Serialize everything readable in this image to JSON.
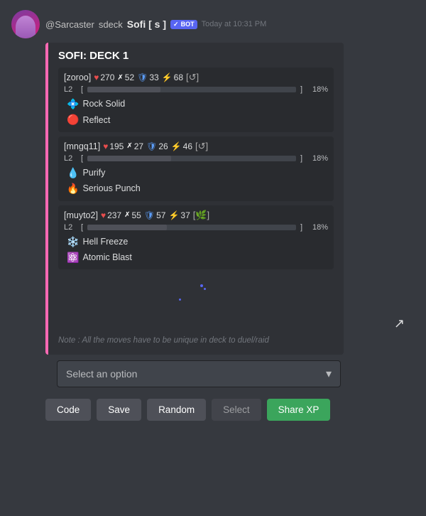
{
  "chat": {
    "user": {
      "username": "@Sarcaster",
      "sdeck": "sdeck"
    },
    "bot": {
      "name": "Sofi [ s ]",
      "badge": "BOT",
      "timestamp": "Today at 10:31 PM"
    },
    "embed": {
      "title": "SOFI: DECK 1",
      "cards": [
        {
          "player": "[zoroo]",
          "heart": 270,
          "cross": 52,
          "shield": 33,
          "bolt": 68,
          "icon": "↺",
          "level": "L2",
          "progress": 35,
          "progress_pct": "18%",
          "moves": [
            {
              "icon": "💠",
              "name": "Rock Solid"
            },
            {
              "icon": "🔴",
              "name": "Reflect"
            }
          ]
        },
        {
          "player": "[mngq11]",
          "heart": 195,
          "cross": 27,
          "shield": 26,
          "bolt": 46,
          "icon": "↺",
          "level": "L2",
          "progress": 40,
          "progress_pct": "18%",
          "moves": [
            {
              "icon": "💧",
              "name": "Purify"
            },
            {
              "icon": "🔥",
              "name": "Serious Punch"
            }
          ]
        },
        {
          "player": "[muyto2]",
          "heart": 237,
          "cross": 55,
          "shield": 57,
          "bolt": 37,
          "icon": "🌿",
          "level": "L2",
          "progress": 38,
          "progress_pct": "18%",
          "moves": [
            {
              "icon": "❄️",
              "name": "Hell Freeze"
            },
            {
              "icon": "⚛️",
              "name": "Atomic Blast"
            }
          ]
        }
      ],
      "note": "Note : All the moves have to be unique in deck to duel/raid"
    },
    "dropdown": {
      "placeholder": "Select an option"
    },
    "buttons": [
      {
        "id": "code",
        "label": "Code",
        "type": "secondary"
      },
      {
        "id": "save",
        "label": "Save",
        "type": "secondary"
      },
      {
        "id": "random",
        "label": "Random",
        "type": "secondary"
      },
      {
        "id": "select",
        "label": "Select",
        "type": "disabled"
      },
      {
        "id": "share_xp",
        "label": "Share XP",
        "type": "primary"
      }
    ]
  }
}
